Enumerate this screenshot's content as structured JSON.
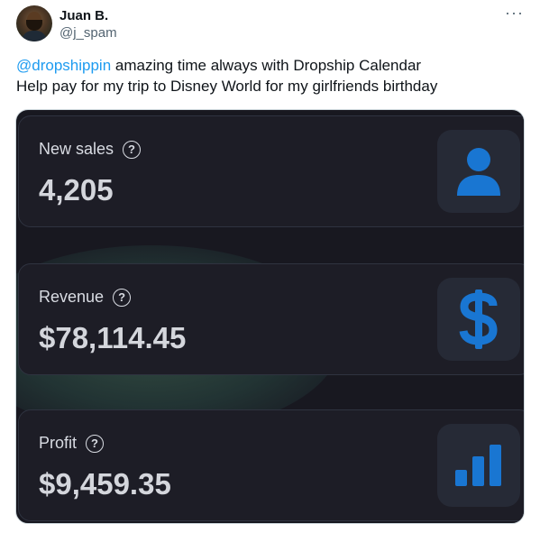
{
  "author": {
    "name": "Juan B.",
    "handle": "@j_spam",
    "more_label": "···"
  },
  "tweet": {
    "mention": "@dropshippin",
    "line1_rest": " amazing time always with Dropship Calendar",
    "line2": "Help pay for my trip to Disney World for my girlfriends birthday"
  },
  "stats": [
    {
      "label": "New sales",
      "value": "4,205",
      "icon": "user-icon"
    },
    {
      "label": "Revenue",
      "value": "$78,114.45",
      "icon": "dollar-icon"
    },
    {
      "label": "Profit",
      "value": "$9,459.35",
      "icon": "bar-chart-icon"
    }
  ],
  "help_glyph": "?",
  "colors": {
    "accent_blue": "#1976d2",
    "link": "#1d9bf0"
  }
}
